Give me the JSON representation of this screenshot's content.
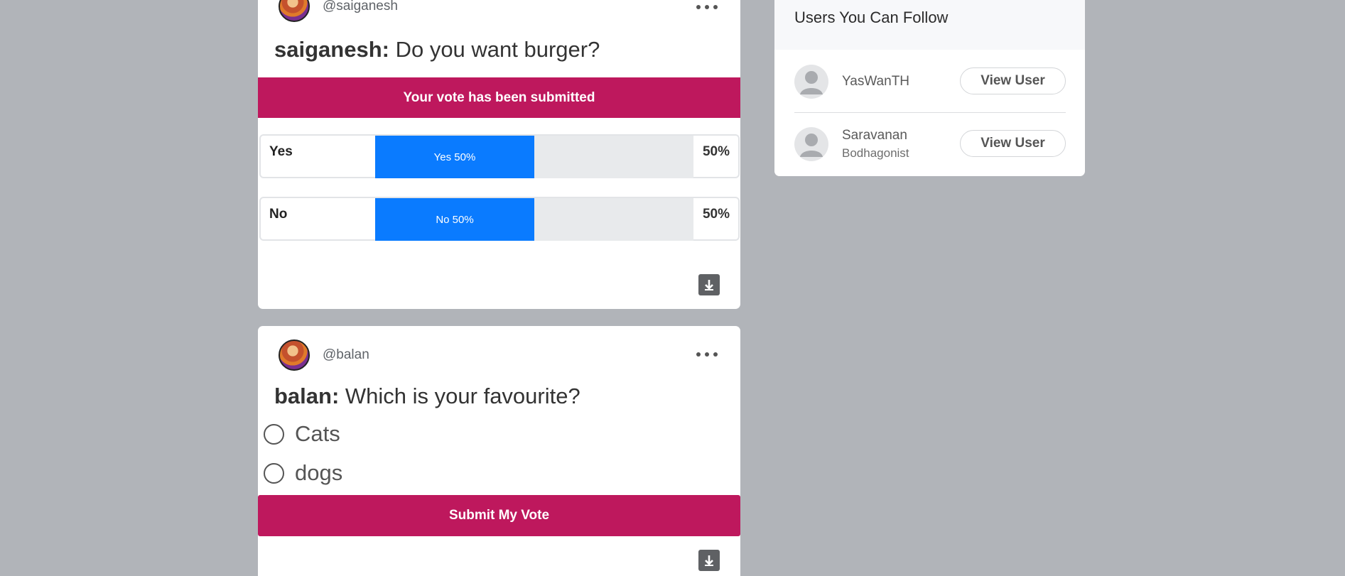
{
  "colors": {
    "accent": "#be185d",
    "bar": "#0a7bff",
    "background": "#b1b4b9"
  },
  "poll1": {
    "handle": "@saiganesh",
    "author": "saiganesh:",
    "question": "Do you want burger?",
    "banner": "Your vote has been submitted",
    "results": [
      {
        "label": "Yes",
        "bar_text": "Yes 50%",
        "percent": "50%",
        "fraction": 0.5
      },
      {
        "label": "No",
        "bar_text": "No 50%",
        "percent": "50%",
        "fraction": 0.5
      }
    ],
    "more_icon": "more-horizontal-icon",
    "download_icon": "download-icon"
  },
  "poll2": {
    "handle": "@balan",
    "author": "balan:",
    "question": "Which is your favourite?",
    "options": [
      "Cats",
      "dogs"
    ],
    "submit_label": "Submit My Vote",
    "more_icon": "more-horizontal-icon",
    "download_icon": "download-icon"
  },
  "sidebar": {
    "title": "Users You Can Follow",
    "users": [
      {
        "name": "YasWanTH",
        "subtitle": "",
        "button": "View User"
      },
      {
        "name": "Saravanan",
        "subtitle": "Bodhagonist",
        "button": "View User"
      }
    ]
  }
}
